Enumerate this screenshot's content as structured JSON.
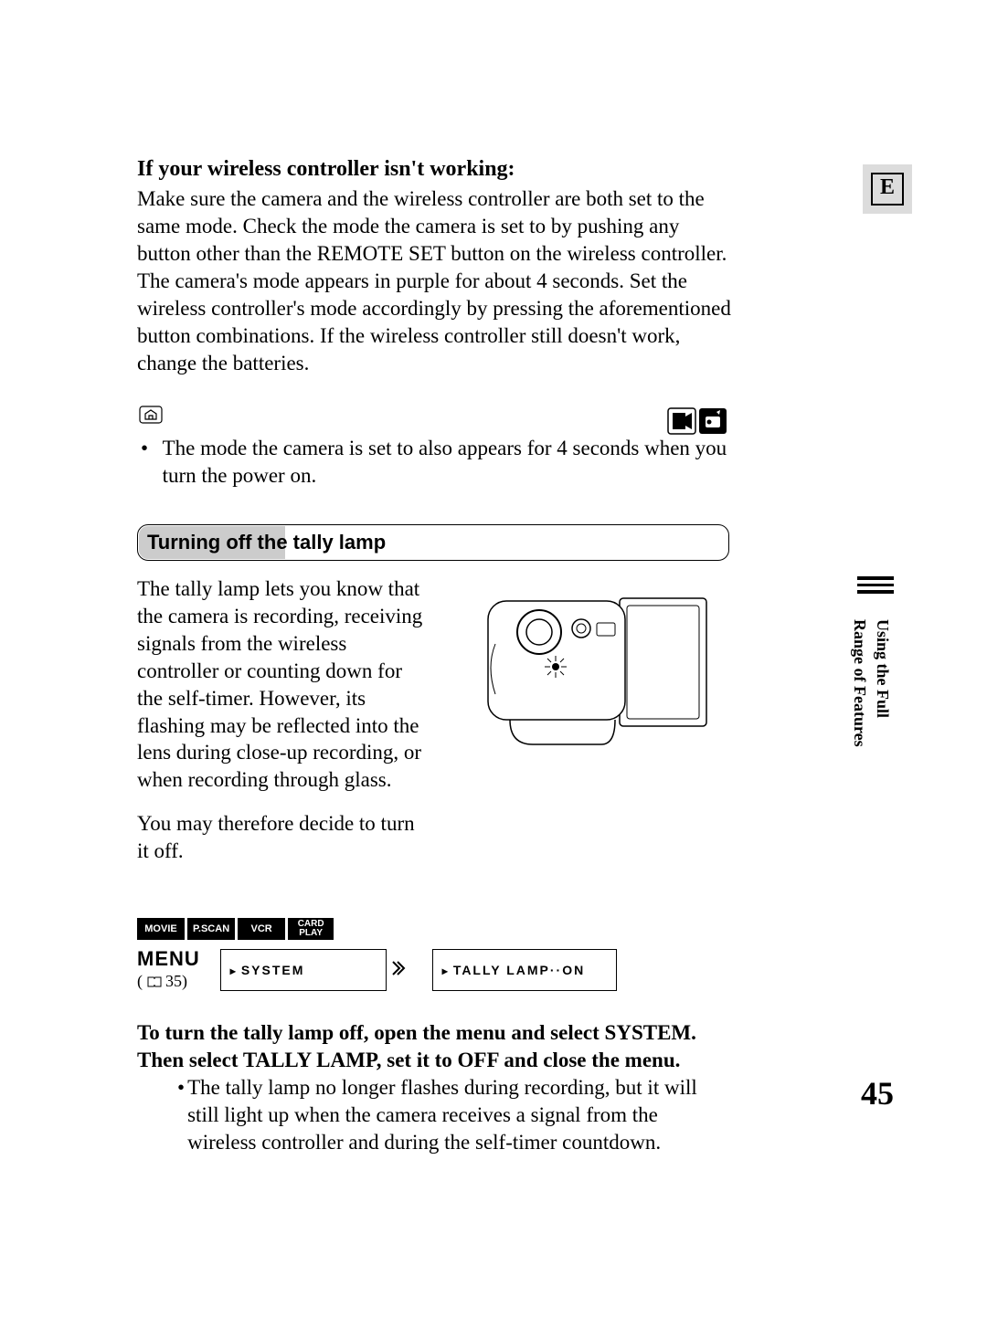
{
  "lang_badge": "E",
  "section1": {
    "heading": "If your wireless controller isn't working:",
    "body": "Make sure the camera and the wireless controller are both set to the same mode. Check the mode the camera is set to by pushing any button other than the REMOTE SET button on the wireless controller. The camera's mode appears in purple for about 4 seconds. Set the wireless controller's mode accordingly by pressing the aforementioned button combinations. If the wireless controller still doesn't work, change the batteries.",
    "note_bullet": "The mode the camera is set to also appears for 4 seconds when you turn the power on."
  },
  "section2": {
    "title": "Turning off the tally lamp",
    "para1": "The tally lamp lets you know that the camera is recording, receiving signals from the wireless controller or counting down for the self-timer. However, its flashing may be reflected into the lens during close-up recording, or when recording through glass.",
    "para2": "You may therefore decide to turn it off."
  },
  "modes": [
    "MOVIE",
    "P.SCAN",
    "VCR"
  ],
  "mode_stack": {
    "top": "CARD",
    "bottom": "PLAY"
  },
  "menu": {
    "label": "MENU",
    "ref_num": "35",
    "path1": "SYSTEM",
    "path2": "TALLY LAMP··ON"
  },
  "instructions": {
    "bold": "To turn the tally lamp off, open the menu and select SYSTEM. Then select TALLY LAMP, set it to OFF and close the menu.",
    "bullet": "The tally lamp no longer flashes during recording, but it will still light up when the camera receives a signal from the wireless controller and during the self-timer countdown."
  },
  "side_label": {
    "line1": "Using the Full",
    "line2": "Range of Features"
  },
  "page_number": "45"
}
